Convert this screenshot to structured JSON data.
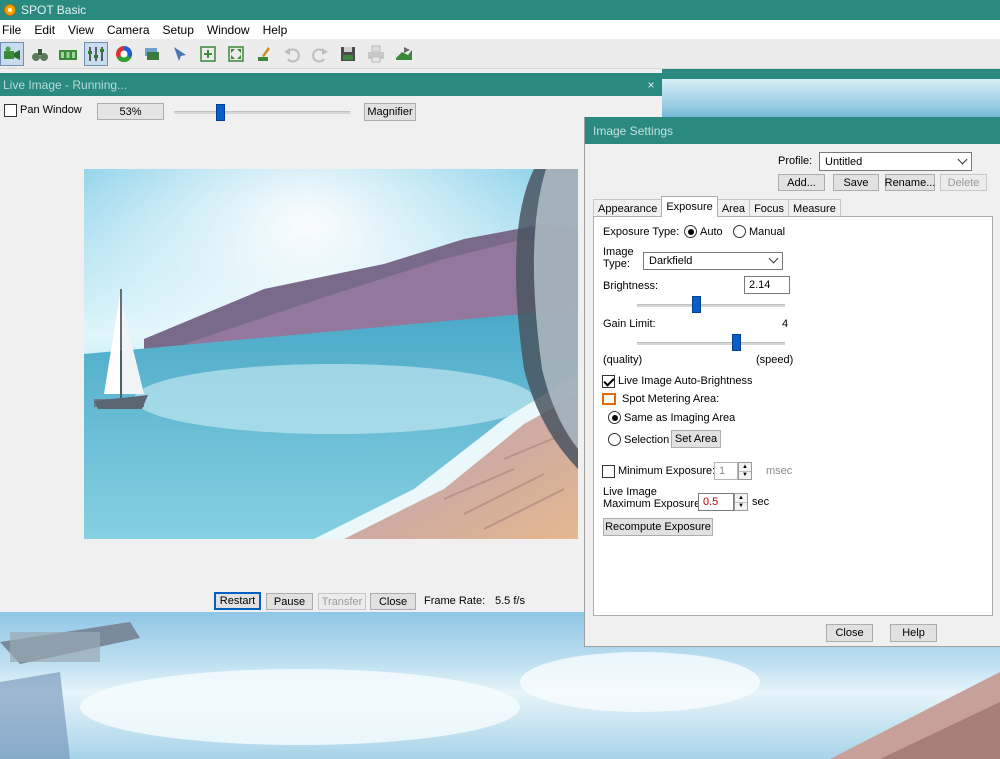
{
  "app": {
    "title": "SPOT Basic"
  },
  "menu": [
    "File",
    "Edit",
    "View",
    "Camera",
    "Setup",
    "Window",
    "Help"
  ],
  "toolbar": {
    "icons": [
      "camera-icon",
      "binoculars-icon",
      "film-strip-icon",
      "levels-icon",
      "color-wheel-icon",
      "layers-icon",
      "pointer-icon",
      "zoom-in-icon",
      "fit-window-icon",
      "edit-pencil-icon",
      "undo-icon",
      "redo-icon",
      "save-icon",
      "print-icon",
      "export-icon"
    ]
  },
  "live_window": {
    "title": "Live Image - Running...",
    "close_glyph": "×",
    "pan_window_label": "Pan Window",
    "zoom_value": "53%",
    "zoom_slider_fraction": 0.26,
    "magnifier_label": "Magnifier",
    "restart_label": "Restart",
    "pause_label": "Pause",
    "transfer_label": "Transfer",
    "close_label": "Close",
    "frame_rate_label": "Frame Rate:",
    "frame_rate_value": "5.5 f/s"
  },
  "settings": {
    "title": "Image Settings",
    "profile_label": "Profile:",
    "profile_value": "Untitled",
    "add_label": "Add...",
    "save_label": "Save",
    "rename_label": "Rename...",
    "delete_label": "Delete",
    "tabs": [
      "Appearance",
      "Exposure",
      "Area",
      "Focus",
      "Measure"
    ],
    "active_tab": "Exposure",
    "exposure_type_label": "Exposure Type:",
    "auto_label": "Auto",
    "manual_label": "Manual",
    "image_type_label_1": "Image",
    "image_type_label_2": "Type:",
    "image_type_value": "Darkfield",
    "brightness_label": "Brightness:",
    "brightness_value": "2.14",
    "brightness_slider_fraction": 0.4,
    "gain_limit_label": "Gain Limit:",
    "gain_limit_value": "4",
    "gain_slider_fraction": 0.67,
    "quality_label": "(quality)",
    "speed_label": "(speed)",
    "auto_brightness_label": "Live Image Auto-Brightness",
    "spot_metering_label": "Spot Metering Area:",
    "same_as_imaging_label": "Same as Imaging Area",
    "selection_label": "Selection",
    "set_area_label": "Set Area",
    "min_exposure_label": "Minimum Exposure:",
    "min_exposure_value": "1",
    "msec_label": "msec",
    "max_exposure_label_1": "Live Image",
    "max_exposure_label_2": "Maximum Exposure:",
    "max_exposure_value": "0.5",
    "sec_label": "sec",
    "recompute_label": "Recompute Exposure",
    "close_label": "Close",
    "help_label": "Help",
    "accent_orange": "#e06a10"
  }
}
